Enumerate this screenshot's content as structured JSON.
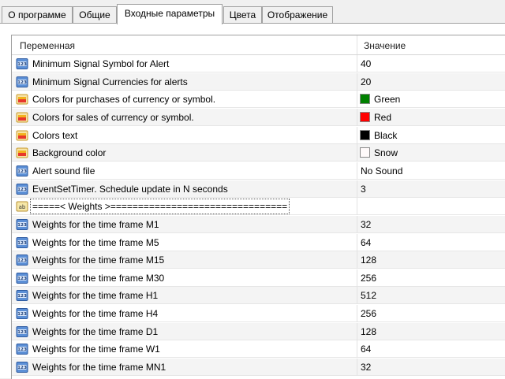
{
  "tabs": [
    {
      "label": "О программе",
      "active": false
    },
    {
      "label": "Общие",
      "active": false
    },
    {
      "label": "Входные параметры",
      "active": true
    },
    {
      "label": "Цвета",
      "active": false
    },
    {
      "label": "Отображение",
      "active": false
    }
  ],
  "table": {
    "columns": [
      "Переменная",
      "Значение"
    ],
    "rows": [
      {
        "icon": "int-icon",
        "name": "Minimum Signal Symbol for Alert",
        "value": "40"
      },
      {
        "icon": "int-icon",
        "name": "Minimum Signal Currencies for alerts",
        "value": "20"
      },
      {
        "icon": "color-icon",
        "name": "Colors for purchases of currency or symbol.",
        "value": "Green",
        "swatch": "#008000"
      },
      {
        "icon": "color-icon",
        "name": "Colors for sales of currency or symbol.",
        "value": "Red",
        "swatch": "#ff0000"
      },
      {
        "icon": "color-icon",
        "name": "Colors text",
        "value": "Black",
        "swatch": "#000000"
      },
      {
        "icon": "color-icon",
        "name": "Background color",
        "value": "Snow",
        "swatch": "#fffafa"
      },
      {
        "icon": "int-icon",
        "name": "Alert sound file",
        "value": "No Sound"
      },
      {
        "icon": "int-icon",
        "name": "EventSetTimer.  Schedule update in N seconds",
        "value": "3"
      },
      {
        "icon": "string-icon",
        "name": "=====< Weights >================================",
        "value": "",
        "selected": true
      },
      {
        "icon": "int-icon",
        "name": "Weights for the time frame M1",
        "value": "32"
      },
      {
        "icon": "int-icon",
        "name": "Weights for the time frame M5",
        "value": "64"
      },
      {
        "icon": "int-icon",
        "name": "Weights for the time frame M15",
        "value": "128"
      },
      {
        "icon": "int-icon",
        "name": "Weights for the time frame M30",
        "value": "256"
      },
      {
        "icon": "int-icon",
        "name": "Weights for the time frame H1",
        "value": "512"
      },
      {
        "icon": "int-icon",
        "name": "Weights for the time frame H4",
        "value": "256"
      },
      {
        "icon": "int-icon",
        "name": "Weights for the time frame D1",
        "value": "128"
      },
      {
        "icon": "int-icon",
        "name": "Weights for the time frame W1",
        "value": "64"
      },
      {
        "icon": "int-icon",
        "name": "Weights for the time frame MN1",
        "value": "32"
      }
    ]
  }
}
